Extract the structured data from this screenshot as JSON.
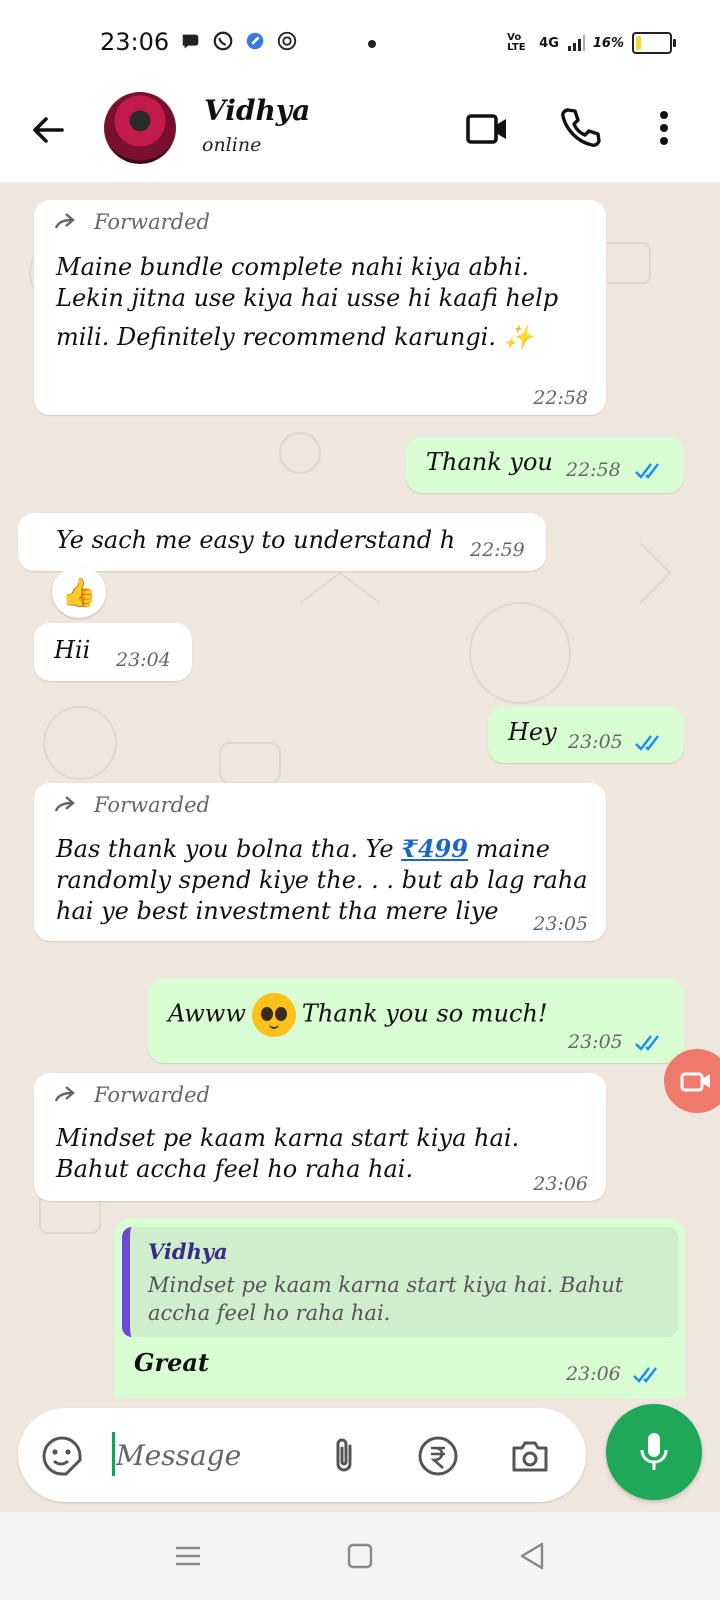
{
  "status_bar": {
    "time": "23:06",
    "network": "4G",
    "volte": "Vo LTE",
    "battery": "16%",
    "battery_level": 0.16
  },
  "header": {
    "contact_name": "Vidhya",
    "contact_status": "online"
  },
  "messages": [
    {
      "dir": "in",
      "forwarded_label": "Forwarded",
      "text_lines": [
        "Maine bundle complete nahi kiya abhi.",
        "Lekin jitna use kiya hai usse hi kaafi help",
        "mili.  Definitely recommend karungi.  ✨"
      ],
      "time": "22:58"
    },
    {
      "dir": "out",
      "text": "Thank you",
      "time": "22:58",
      "status": "read"
    },
    {
      "dir": "in",
      "text": "Ye sach me easy to understand h",
      "time": "22:59",
      "reaction": "👍"
    },
    {
      "dir": "in",
      "text": "Hii",
      "time": "23:04"
    },
    {
      "dir": "out",
      "text": "Hey",
      "time": "23:05",
      "status": "read"
    },
    {
      "dir": "in",
      "forwarded_label": "Forwarded",
      "text_pre": "Bas thank you bolna tha.  Ye ",
      "link": "₹499",
      "text_post": " maine",
      "text_lines": [
        "randomly spend kiye the. . .  but ab lag raha",
        "hai ye best investment tha mere liye"
      ],
      "time": "23:05"
    },
    {
      "dir": "out",
      "text_pre": "Awww",
      "emoji": "pleading-face",
      "text_post": "Thank you so much!",
      "time": "23:05",
      "status": "read"
    },
    {
      "dir": "in",
      "forwarded_label": "Forwarded",
      "text_lines": [
        "Mindset pe kaam karna start kiya hai.",
        "Bahut accha feel ho raha hai."
      ],
      "time": "23:06"
    },
    {
      "dir": "out",
      "quote_author": "Vidhya",
      "quote_lines": [
        "Mindset pe kaam karna start kiya hai.  Bahut",
        "accha feel ho raha hai."
      ],
      "text": "Great",
      "time": "23:06",
      "status": "read"
    }
  ],
  "composer": {
    "placeholder": "Message"
  },
  "colors": {
    "outgoing_bubble": "#d9fdd3",
    "incoming_bubble": "#ffffff",
    "read_tick": "#1a8cff",
    "accent": "#1fa85a",
    "link": "#1b67c9"
  }
}
